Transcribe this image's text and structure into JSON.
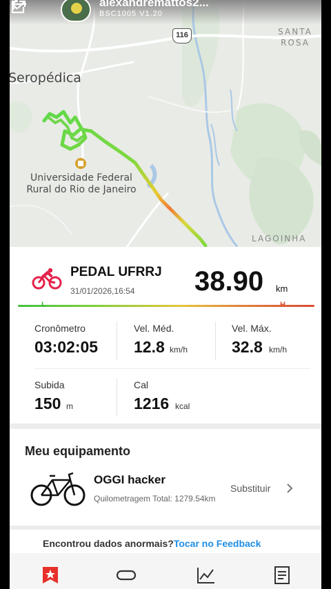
{
  "header": {
    "user_name": "alexandremattos2...",
    "device": "BSC1005 V1.20",
    "icons": [
      "back-arrow-icon",
      "share-icon",
      "more-icon"
    ]
  },
  "map": {
    "place_seropedica": "Seropédica",
    "place_santa_rosa": "SANTA ROSA",
    "place_lagoinha": "LAGOINHA",
    "place_university": "Universidade Federal Rural do Rio de Janeiro",
    "road_shield": "116"
  },
  "activity": {
    "title": "PEDAL UFRRJ",
    "date": "31/01/2026,16:54",
    "distance": "38.90",
    "distance_unit": "km",
    "intensity_low": "L",
    "intensity_high": "H",
    "icon": "bike-icon",
    "color": "#e5214a"
  },
  "metrics": {
    "cronometro_label": "Cronômetro",
    "cronometro_value": "03:02:05",
    "vel_med_label": "Vel. Méd.",
    "vel_med_value": "12.8",
    "vel_med_unit": "km/h",
    "vel_max_label": "Vel. Máx.",
    "vel_max_value": "32.8",
    "vel_max_unit": "km/h",
    "subida_label": "Subida",
    "subida_value": "150",
    "subida_unit": "m",
    "cal_label": "Cal",
    "cal_value": "1216",
    "cal_unit": "kcal"
  },
  "equipment": {
    "title": "Meu equipamento",
    "name": "OGGI hacker",
    "km_label": "Quilometragem Total: 1279.54km",
    "replace_label": "Substituir"
  },
  "feedback": {
    "text": "Encontrou dados anormais?",
    "link": "Tocar no Feedback"
  },
  "nav": {
    "items": [
      "star-icon",
      "device-icon",
      "chart-icon",
      "report-icon"
    ],
    "active_color": "#e8302a"
  }
}
